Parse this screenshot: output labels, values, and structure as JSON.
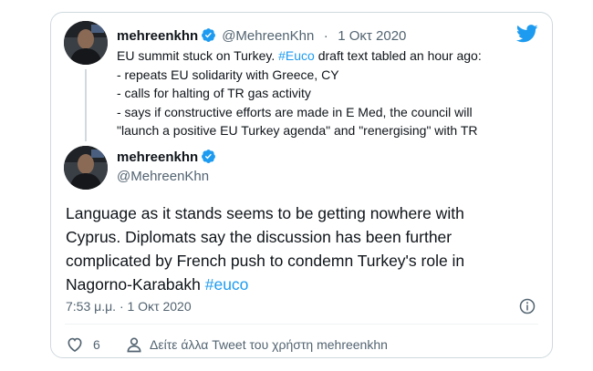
{
  "parent_tweet": {
    "display_name": "mehreenkhn",
    "handle": "@MehreenKhn",
    "separator": "·",
    "date": "1 Οκτ 2020",
    "text_lines": {
      "l1_pre": "EU summit stuck on Turkey. ",
      "l1_tag": "#Euco",
      "l1_post": " draft text tabled an hour ago:",
      "l2": "- repeats EU solidarity with Greece, CY",
      "l3": "- calls for halting of TR gas activity",
      "l4": "- says if constructive efforts are made in E Med, the council will",
      "l5": "\"launch a positive EU Turkey agenda\" and \"renergising\" with TR"
    }
  },
  "main_tweet": {
    "display_name": "mehreenkhn",
    "handle": "@MehreenKhn",
    "text_lines": {
      "l1": "Language as it stands seems to be getting nowhere with",
      "l2": "Cyprus. Diplomats say the discussion has been further",
      "l3": "complicated by French push to condemn Turkey's role in",
      "l4_pre": "Nagorno-Karabakh ",
      "l4_tag": "#euco"
    },
    "timestamp": "7:53 μ.μ. · 1 Οκτ 2020",
    "like_count": "6",
    "more_tweets_label": "Δείτε άλλα Tweet του χρήστη mehreenkhn"
  },
  "colors": {
    "accent": "#1d9bf0",
    "text": "#0f1419",
    "secondary": "#536471",
    "border": "#cfd9de"
  },
  "icons": [
    "twitter-bird-icon",
    "verified-badge-icon",
    "info-icon",
    "heart-icon",
    "user-icon"
  ]
}
